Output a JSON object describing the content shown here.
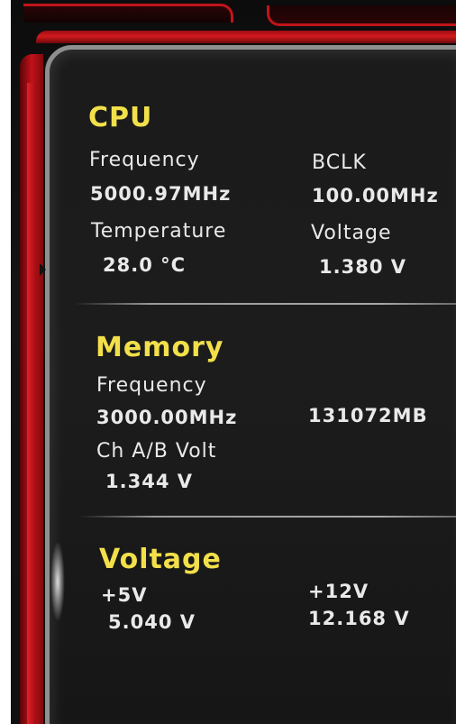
{
  "cpu": {
    "title": "CPU",
    "frequency_label": "Frequency",
    "frequency_value": "5000.97MHz",
    "bclk_label": "BCLK",
    "bclk_value": "100.00MHz",
    "temperature_label": "Temperature",
    "temperature_value": "28.0 °C",
    "voltage_label": "Voltage",
    "voltage_value": "1.380 V"
  },
  "memory": {
    "title": "Memory",
    "frequency_label": "Frequency",
    "frequency_value": "3000.00MHz",
    "size_value": "131072MB",
    "volt_label": "Ch A/B Volt",
    "volt_value": "1.344 V"
  },
  "voltage": {
    "title": "Voltage",
    "v5_label": "+5V",
    "v5_value": "5.040 V",
    "v12_label": "+12V",
    "v12_value": "12.168 V"
  },
  "colors": {
    "heading": "#f2e04a",
    "text": "#e9e9e9",
    "frame_red": "#c0141a",
    "background": "#141414"
  }
}
